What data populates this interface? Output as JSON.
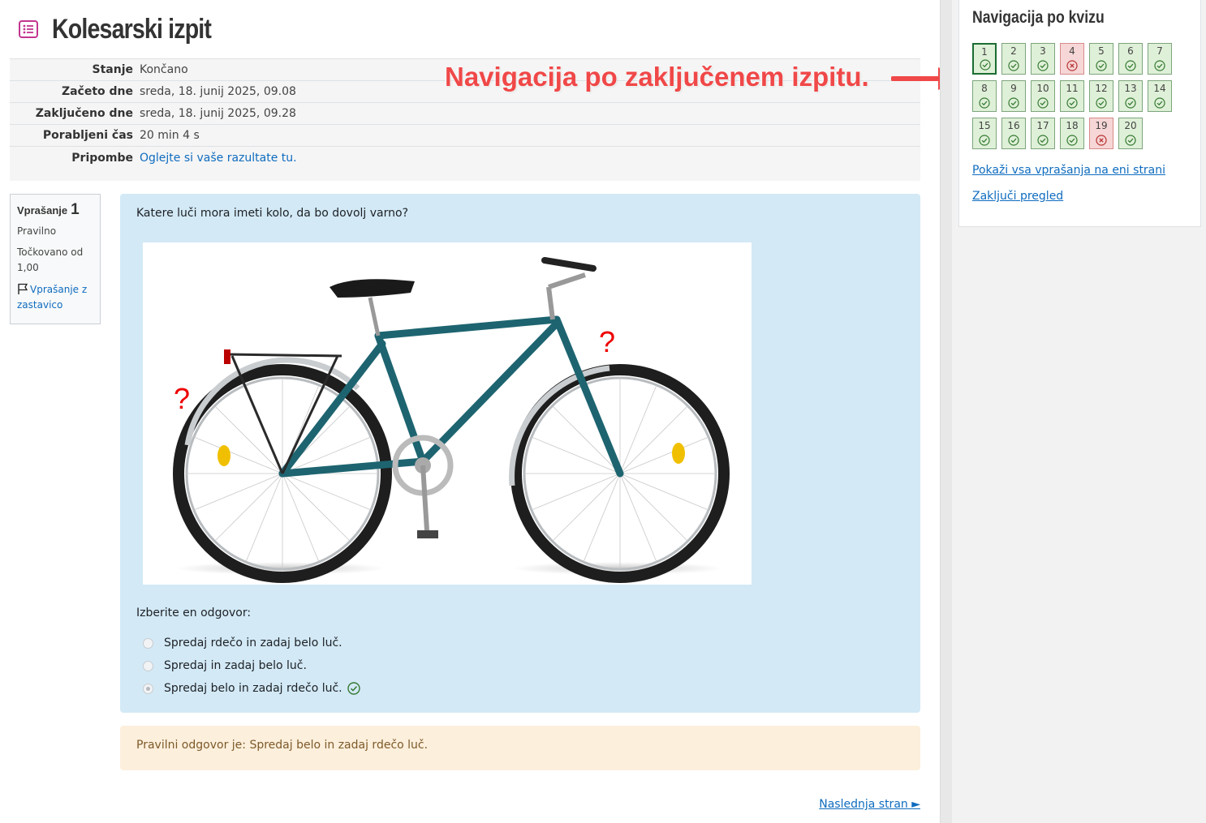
{
  "header": {
    "title": "Kolesarski izpit"
  },
  "summary": {
    "rows": [
      {
        "label": "Stanje",
        "value": "Končano"
      },
      {
        "label": "Začeto dne",
        "value": "sreda, 18. junij 2025, 09.08"
      },
      {
        "label": "Zaključeno dne",
        "value": "sreda, 18. junij 2025, 09.28"
      },
      {
        "label": "Porabljeni čas",
        "value": "20 min 4 s"
      },
      {
        "label": "Pripombe",
        "value": "Oglejte si vaše razultate tu."
      }
    ]
  },
  "question_info": {
    "label": "Vprašanje",
    "number": "1",
    "state": "Pravilno",
    "grade": "Točkovano od 1,00",
    "flag": "Vprašanje z zastavico"
  },
  "question": {
    "text": "Katere luči mora imeti kolo, da bo dovolj varno?",
    "prompt": "Izberite en odgovor:",
    "answers": [
      {
        "label": "Spredaj rdečo in zadaj belo luč.",
        "selected": false,
        "correct": false
      },
      {
        "label": "Spredaj in zadaj belo luč.",
        "selected": false,
        "correct": false
      },
      {
        "label": "Spredaj belo in zadaj rdečo luč.",
        "selected": true,
        "correct": true
      }
    ],
    "image_marks": [
      "?",
      "?"
    ]
  },
  "feedback": {
    "text": "Pravilni odgovor je: Spredaj belo in zadaj rdečo luč."
  },
  "next_page": {
    "label": "Naslednja stran ►"
  },
  "navigation": {
    "title": "Navigacija po kvizu",
    "questions": [
      {
        "n": "1",
        "state": "correct",
        "current": true
      },
      {
        "n": "2",
        "state": "correct"
      },
      {
        "n": "3",
        "state": "correct"
      },
      {
        "n": "4",
        "state": "wrong"
      },
      {
        "n": "5",
        "state": "correct"
      },
      {
        "n": "6",
        "state": "correct"
      },
      {
        "n": "7",
        "state": "correct"
      },
      {
        "n": "8",
        "state": "correct"
      },
      {
        "n": "9",
        "state": "correct"
      },
      {
        "n": "10",
        "state": "correct"
      },
      {
        "n": "11",
        "state": "correct"
      },
      {
        "n": "12",
        "state": "correct"
      },
      {
        "n": "13",
        "state": "correct"
      },
      {
        "n": "14",
        "state": "correct"
      },
      {
        "n": "15",
        "state": "correct"
      },
      {
        "n": "16",
        "state": "correct"
      },
      {
        "n": "17",
        "state": "correct"
      },
      {
        "n": "18",
        "state": "correct"
      },
      {
        "n": "19",
        "state": "wrong"
      },
      {
        "n": "20",
        "state": "correct"
      }
    ],
    "show_all_label": "Pokaži vsa vprašanja na eni strani",
    "finish_label": "Zaključi pregled"
  },
  "annotation": {
    "text": "Navigacija po zaključenem izpitu."
  },
  "colors": {
    "link": "#0f6cbf",
    "correct_bg": "#dff0d8",
    "wrong_bg": "#f6d6d6",
    "question_bg": "#d3e9f6",
    "feedback_bg": "#fcefdc",
    "annotation": "#f04848"
  },
  "icons": [
    "quiz-icon",
    "flag-icon",
    "check-circle-icon",
    "cross-circle-icon",
    "arrow-right-icon"
  ]
}
